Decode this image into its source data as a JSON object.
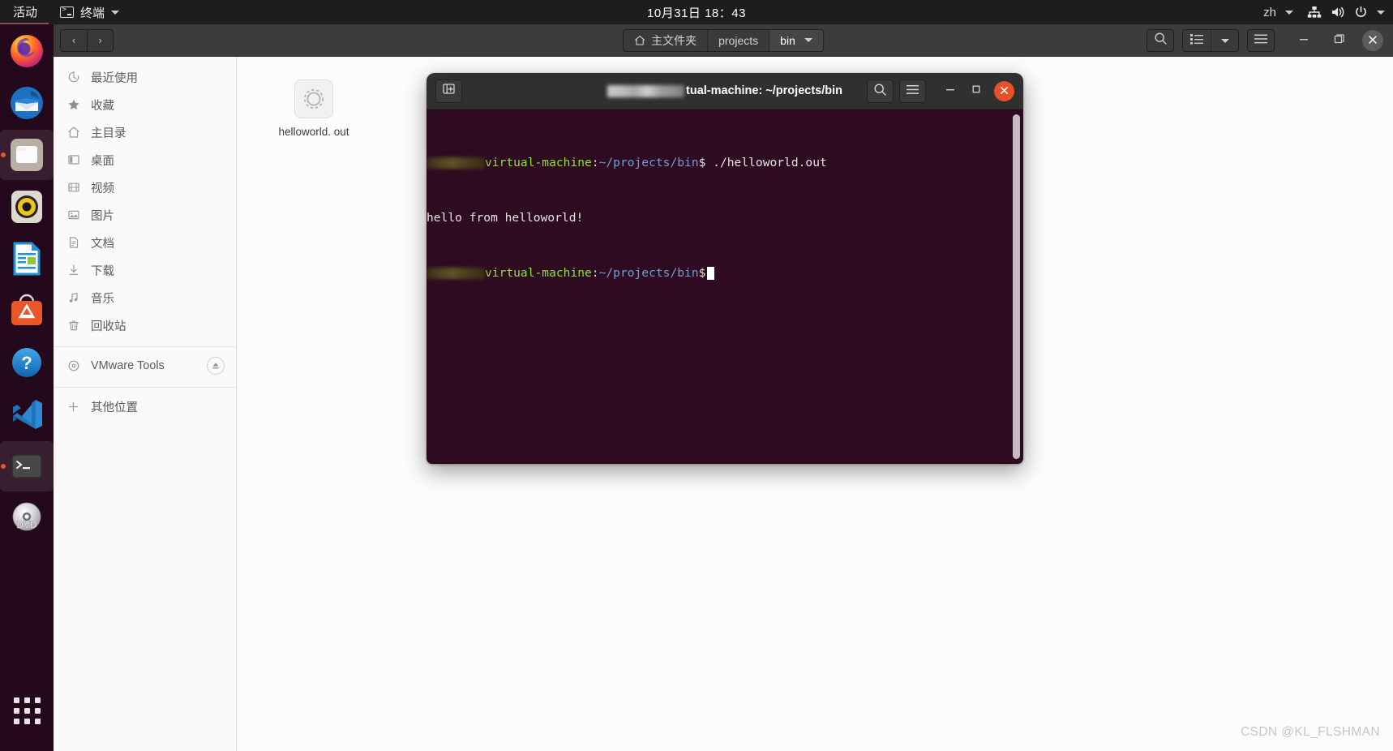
{
  "topbar": {
    "activities": "活动",
    "app_name": "终端",
    "app_icon": "terminal-icon",
    "clock": "10月31日  18：43",
    "keyboard_layout": "zh",
    "indicators": [
      "network-icon",
      "volume-icon",
      "power-icon",
      "chevron-down-icon"
    ]
  },
  "dock": {
    "items": [
      {
        "name": "firefox",
        "icon": "firefox-icon",
        "running": false
      },
      {
        "name": "thunderbird",
        "icon": "thunderbird-icon",
        "running": false
      },
      {
        "name": "files",
        "icon": "files-folder-icon",
        "running": true
      },
      {
        "name": "rhythmbox",
        "icon": "rhythmbox-speaker-icon",
        "running": false
      },
      {
        "name": "libreoffice-writer",
        "icon": "libreoffice-writer-icon",
        "running": false
      },
      {
        "name": "ubuntu-software",
        "icon": "ubuntu-software-icon",
        "running": false
      },
      {
        "name": "help",
        "icon": "help-question-icon",
        "running": false
      },
      {
        "name": "vscode",
        "icon": "vscode-icon",
        "running": false
      },
      {
        "name": "terminal",
        "icon": "terminal-icon",
        "running": true
      },
      {
        "name": "dvd-drive",
        "icon": "dvd-disc-icon",
        "running": false
      }
    ],
    "show_applications": "show-applications-grid-icon"
  },
  "filemanager": {
    "nav": {
      "back": "‹",
      "forward": "›"
    },
    "breadcrumbs": [
      {
        "label": "主文件夹",
        "icon": "home-icon",
        "current": false
      },
      {
        "label": "projects",
        "icon": "",
        "current": false
      },
      {
        "label": "bin",
        "icon": "chevron-down-icon",
        "current": true
      }
    ],
    "header_buttons": [
      "search-icon",
      "list-view-icon",
      "view-chevron-down-icon",
      "hamburger-menu-icon"
    ],
    "window_controls": {
      "minimize": "–",
      "maximize": "❐",
      "close": "✕"
    },
    "sidebar": [
      {
        "label": "最近使用",
        "icon": "recent-clock-icon"
      },
      {
        "label": "收藏",
        "icon": "star-icon"
      },
      {
        "label": "主目录",
        "icon": "home-icon"
      },
      {
        "label": "桌面",
        "icon": "desktop-icon"
      },
      {
        "label": "视频",
        "icon": "video-icon"
      },
      {
        "label": "图片",
        "icon": "pictures-icon"
      },
      {
        "label": "文档",
        "icon": "documents-icon"
      },
      {
        "label": "下载",
        "icon": "download-icon"
      },
      {
        "label": "音乐",
        "icon": "music-note-icon"
      },
      {
        "label": "回收站",
        "icon": "trash-icon"
      }
    ],
    "devices": [
      {
        "label": "VMware Tools",
        "icon": "optical-disc-icon",
        "eject": "eject-icon"
      }
    ],
    "other_locations": {
      "label": "其他位置",
      "icon": "plus-icon"
    },
    "files": [
      {
        "name": "helloworld.\nout",
        "icon": "executable-gear-icon"
      }
    ]
  },
  "terminal": {
    "title_suffix": "tual-machine: ~/projects/bin",
    "title_redacted": true,
    "header_buttons": [
      "new-tab-icon",
      "search-icon",
      "hamburger-menu-icon"
    ],
    "window_controls": {
      "minimize": "–",
      "maximize": "□",
      "close": "✕"
    },
    "lines": [
      {
        "type": "prompt",
        "user_redacted": true,
        "host": "virtual-machine",
        "sep": ":",
        "path": "~/projects/bin",
        "dollar": "$",
        "command": " ./helloworld.out"
      },
      {
        "type": "output",
        "text": "hello from helloworld!"
      },
      {
        "type": "prompt",
        "user_redacted": true,
        "host": "virtual-machine",
        "sep": ":",
        "path": "~/projects/bin",
        "dollar": "$",
        "command": "",
        "cursor": true
      }
    ],
    "colors": {
      "background": "#2f0b21",
      "prompt_user_host": "#8ae234",
      "prompt_path": "#729fcf",
      "text": "#e8e4e2"
    }
  },
  "watermark": "CSDN @KL_FLSHMAN"
}
